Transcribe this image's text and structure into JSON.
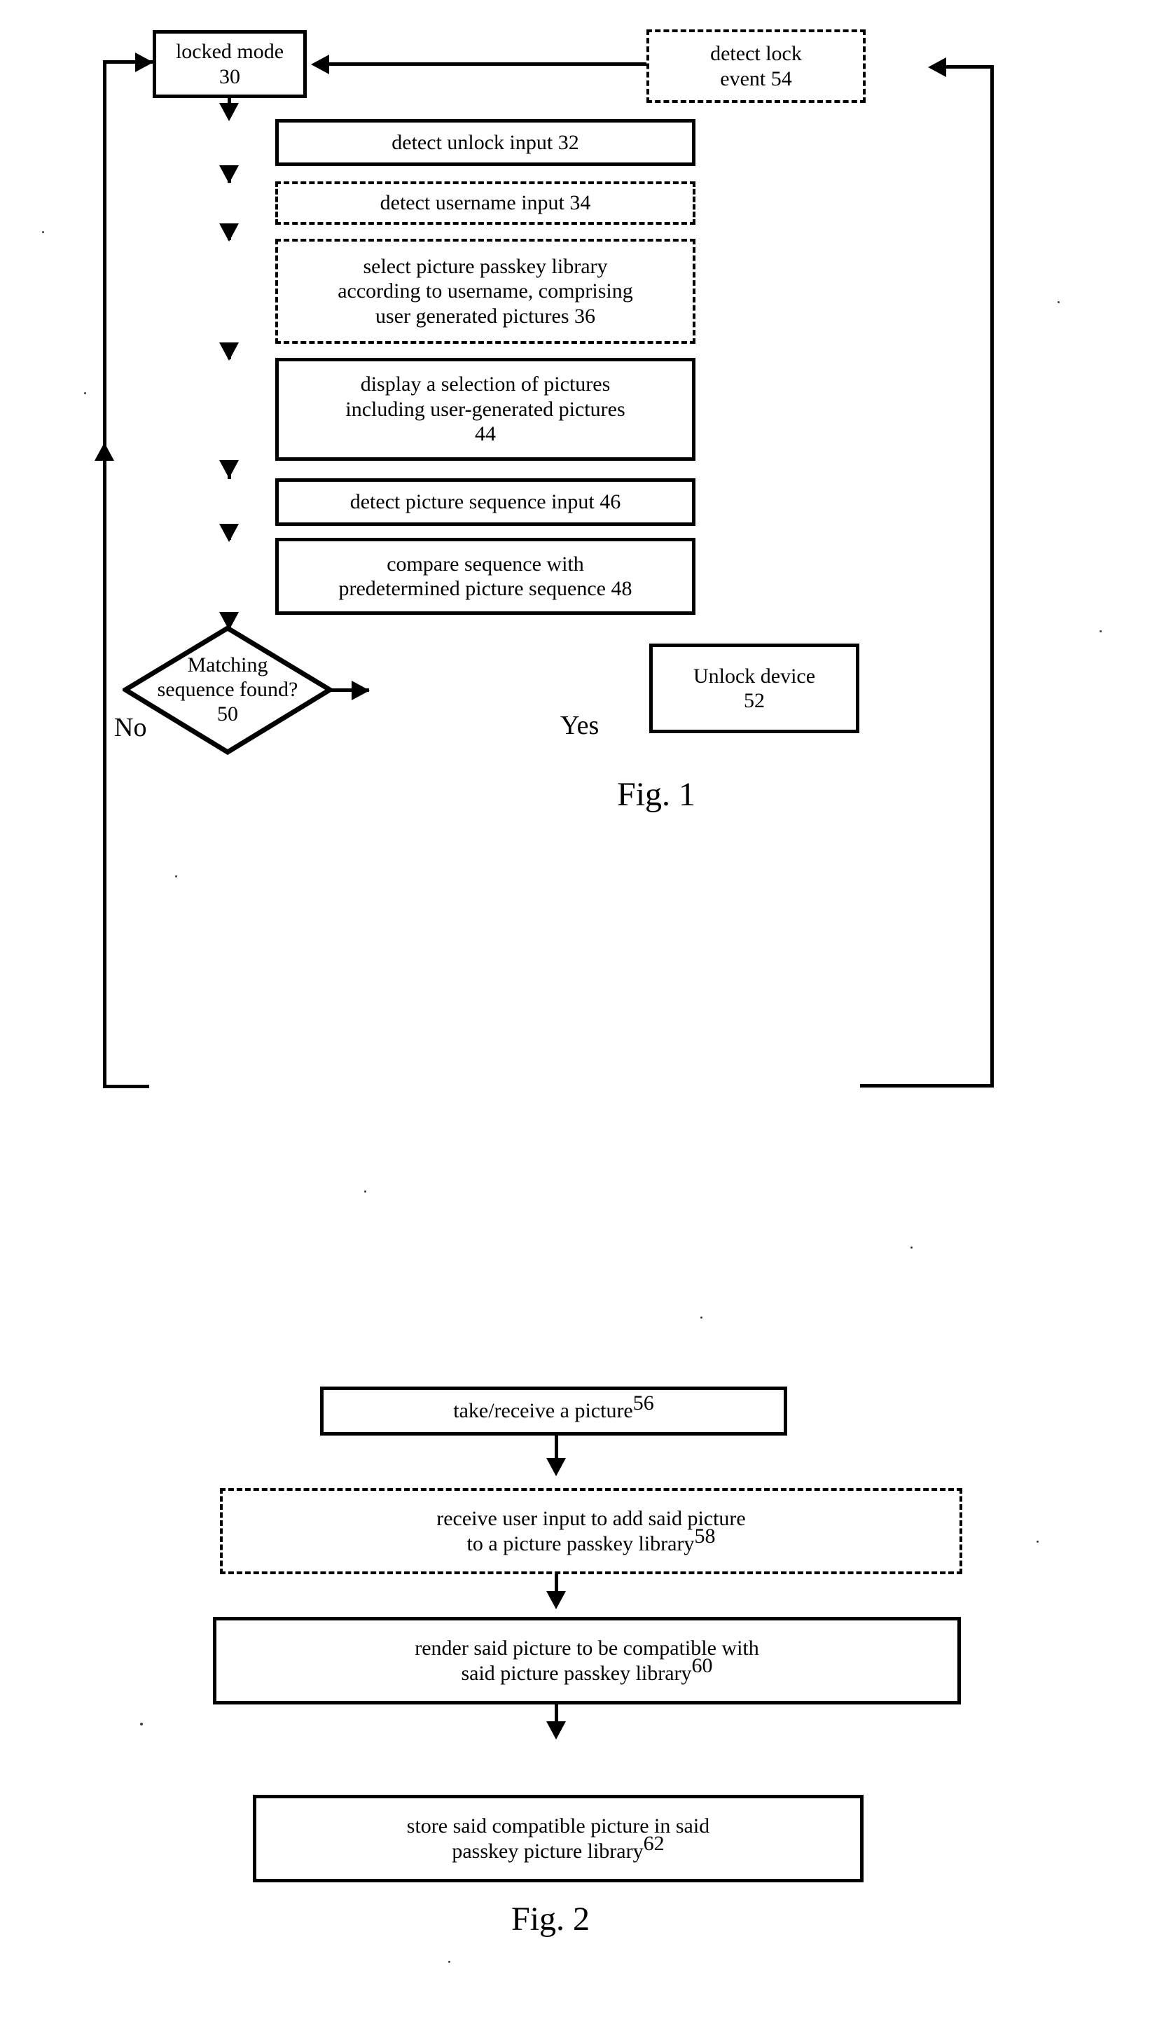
{
  "document": {
    "type": "patent-flowchart-page",
    "figures": [
      {
        "id": "fig1",
        "caption": "Fig. 1",
        "nodes": [
          {
            "ref": "30",
            "text": "locked mode",
            "ref_position": "below",
            "style": "solid",
            "shape": "rect"
          },
          {
            "ref": "54",
            "text": "detect lock event",
            "ref_position": "inline",
            "style": "dashed",
            "shape": "rect"
          },
          {
            "ref": "32",
            "text": "detect unlock input",
            "ref_position": "inline",
            "style": "solid",
            "shape": "rect"
          },
          {
            "ref": "34",
            "text": "detect username input",
            "ref_position": "inline",
            "style": "dashed",
            "shape": "rect"
          },
          {
            "ref": "36",
            "text": "select picture passkey library according to username, comprising user generated pictures",
            "ref_position": "inline",
            "style": "dashed",
            "shape": "rect"
          },
          {
            "ref": "44",
            "text": "display a selection of pictures including user-generated pictures",
            "ref_position": "below",
            "style": "solid",
            "shape": "rect"
          },
          {
            "ref": "46",
            "text": "detect picture sequence input",
            "ref_position": "inline",
            "style": "solid",
            "shape": "rect"
          },
          {
            "ref": "48",
            "text": "compare sequence with predetermined picture sequence",
            "ref_position": "inline",
            "style": "solid",
            "shape": "rect"
          },
          {
            "ref": "50",
            "text": "Matching sequence found?",
            "ref_position": "below",
            "style": "solid",
            "shape": "diamond"
          },
          {
            "ref": "52",
            "text": "Unlock device",
            "ref_position": "below",
            "style": "solid",
            "shape": "rect"
          }
        ],
        "edge_labels": {
          "no": "No",
          "yes": "Yes"
        }
      },
      {
        "id": "fig2",
        "caption": "Fig. 2",
        "nodes": [
          {
            "ref": "56",
            "text": "take/receive a picture",
            "ref_position": "superscript",
            "style": "solid",
            "shape": "rect"
          },
          {
            "ref": "58",
            "text": "receive user input to add said picture to a picture passkey library",
            "ref_position": "superscript",
            "style": "dashed",
            "shape": "rect"
          },
          {
            "ref": "60",
            "text": "render said picture to be compatible with said picture passkey library",
            "ref_position": "superscript",
            "style": "solid",
            "shape": "rect"
          },
          {
            "ref": "62",
            "text": "store said compatible picture in said passkey picture library",
            "ref_position": "superscript",
            "style": "solid",
            "shape": "rect"
          }
        ]
      }
    ]
  },
  "fig1": {
    "caption": "Fig. 1",
    "locked_mode": {
      "line1": "locked mode",
      "ref": "30"
    },
    "detect_lock_event": {
      "line1": "detect lock",
      "line2": "event",
      "ref": "54"
    },
    "detect_unlock_input": {
      "line1": "detect unlock input",
      "ref": "32"
    },
    "detect_username_input": {
      "line1": "detect username input",
      "ref": "34"
    },
    "select_library": {
      "line1": "select picture passkey library",
      "line2": "according to username, comprising",
      "line3": "user generated pictures",
      "ref": "36"
    },
    "display_pictures": {
      "line1": "display a selection of pictures",
      "line2": "including user-generated pictures",
      "ref": "44"
    },
    "detect_sequence": {
      "line1": "detect picture sequence input",
      "ref": "46"
    },
    "compare_sequence": {
      "line1": "compare sequence with",
      "line2": "predetermined picture sequence",
      "ref": "48"
    },
    "decision": {
      "line1": "Matching",
      "line2": "sequence found?",
      "ref": "50"
    },
    "unlock_device": {
      "line1": "Unlock device",
      "ref": "52"
    },
    "label_no": "No",
    "label_yes": "Yes"
  },
  "fig2": {
    "caption": "Fig. 2",
    "take_picture": {
      "line1": "take/receive a picture",
      "ref": "56"
    },
    "receive_user_input": {
      "line1": "receive user input to add said picture",
      "line2": "to a picture passkey library",
      "ref": "58"
    },
    "render_picture": {
      "line1": "render said picture to be compatible with",
      "line2": "said picture passkey library",
      "ref": "60"
    },
    "store_picture": {
      "line1": "store said compatible picture in said",
      "line2": "passkey picture library",
      "ref": "62"
    }
  },
  "colors": {
    "ink": "#000000",
    "paper": "#ffffff"
  }
}
